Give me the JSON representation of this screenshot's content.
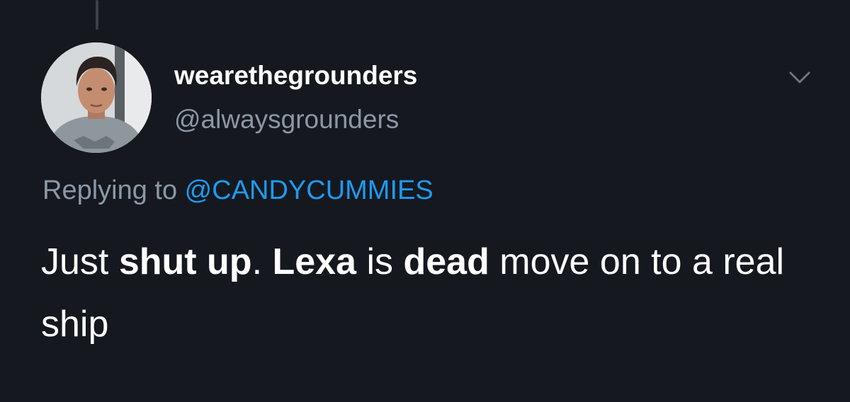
{
  "tweet": {
    "display_name": "wearethegrounders",
    "handle": "@alwaysgrounders",
    "reply_prefix": "Replying to ",
    "reply_mention": "@CANDYCUMMIES",
    "text_segments": [
      {
        "text": "Just ",
        "bold": false
      },
      {
        "text": "shut up",
        "bold": true
      },
      {
        "text": ". ",
        "bold": false
      },
      {
        "text": "Lexa",
        "bold": true
      },
      {
        "text": " is ",
        "bold": false
      },
      {
        "text": "dead",
        "bold": true
      },
      {
        "text": " move on to a real ship",
        "bold": false
      }
    ]
  },
  "icons": {
    "avatar": "avatar-photo",
    "menu": "chevron-down-icon"
  },
  "colors": {
    "background": "#15181f",
    "primary_text": "#ffffff",
    "secondary_text": "#8b98a5",
    "accent": "#1d9bf0",
    "thread_line": "#3a4148"
  }
}
